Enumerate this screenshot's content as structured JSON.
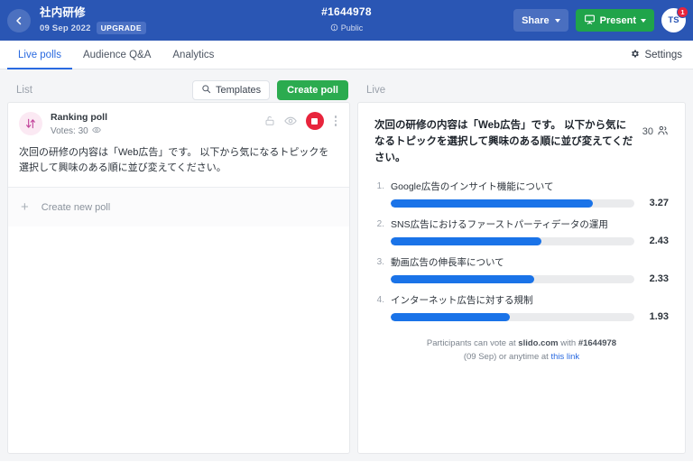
{
  "topbar": {
    "back_icon": "chevron-left-icon",
    "event_title": "社内研修",
    "event_date": "09 Sep 2022",
    "upgrade_label": "UPGRADE",
    "event_code": "#1644978",
    "visibility_icon": "info-circle-icon",
    "visibility_label": "Public",
    "share_label": "Share",
    "present_label": "Present",
    "present_icon": "presentation-icon",
    "avatar_initials": "TS",
    "avatar_badge": "1",
    "accent_blue": "#2a56b4",
    "accent_green": "#20a44a",
    "badge_red": "#e8243c"
  },
  "nav": {
    "tabs": [
      {
        "label": "Live polls",
        "active": true
      },
      {
        "label": "Audience Q&A",
        "active": false
      },
      {
        "label": "Analytics",
        "active": false
      }
    ],
    "settings_label": "Settings",
    "settings_icon": "gear-icon"
  },
  "left_column": {
    "header_title": "List",
    "templates_label": "Templates",
    "templates_icon": "search-icon",
    "create_poll_label": "Create poll",
    "poll_card": {
      "type_icon": "ranking-arrows-icon",
      "type_label": "Ranking poll",
      "votes_label": "Votes: 30",
      "votes_icon": "eye-icon",
      "lock_icon": "unlock-icon",
      "preview_icon": "eye-icon",
      "stop_icon": "stop-square-icon",
      "menu_icon": "kebab-menu-icon",
      "question": "次回の研修の内容は「Web広告」です。 以下から気になるトピックを選択して興味のある順に並び変えてください。"
    },
    "create_new_label": "Create new poll",
    "create_new_icon": "plus-icon"
  },
  "right_column": {
    "header_title": "Live",
    "question": "次回の研修の内容は「Web広告」です。 以下から気になるトピックを選択して興味のある順に並び変えてください。",
    "participants_count": "30",
    "participants_icon": "people-icon",
    "bar_color": "#1a73e8",
    "track_color": "#eaebed",
    "footer": {
      "line1_prefix": "Participants can vote at ",
      "line1_site": "slido.com",
      "line1_middle": " with ",
      "line1_code": "#1644978",
      "line2_prefix": "(09 Sep) or anytime at ",
      "line2_link": "this link"
    }
  },
  "chart_data": {
    "type": "bar",
    "title": "次回の研修の内容は「Web広告」です。 以下から気になるトピックを選択して興味のある順に並び変えてください。",
    "orientation": "horizontal",
    "xlabel": "",
    "ylabel": "",
    "categories": [
      "Google広告のインサイト機能について",
      "SNS広告におけるファーストパーティデータの運用",
      "動画広告の伸長率について",
      "インターネット広告に対する規制"
    ],
    "values": [
      3.27,
      2.43,
      2.33,
      1.93
    ],
    "ranks": [
      "1.",
      "2.",
      "3.",
      "4."
    ],
    "bar_percents": [
      83,
      62,
      59,
      49
    ],
    "xlim": [
      0,
      3.93
    ],
    "grid": false,
    "legend": false
  }
}
